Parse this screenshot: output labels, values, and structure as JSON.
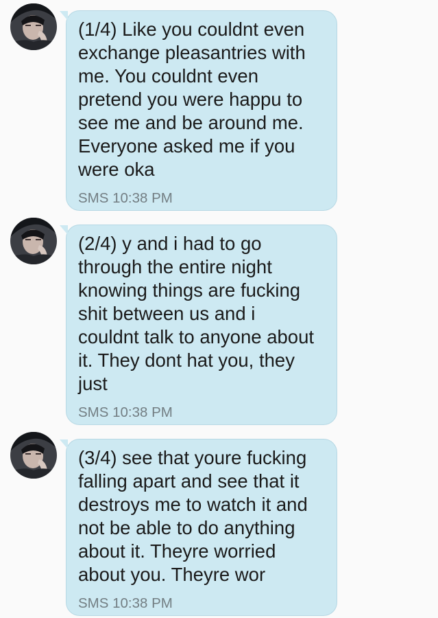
{
  "messages": [
    {
      "text": "(1/4) Like you couldnt even\nexchange pleasantries with\nme. You couldnt even\npretend you were happu to\nsee me and be around me.\nEveryone asked me if you\nwere oka",
      "meta": "SMS 10:38 PM",
      "avatar": "contact-avatar-photo"
    },
    {
      "text": "(2/4) y and i had to go\nthrough the entire night\nknowing things are fucking\nshit between us and i\ncouldnt talk to anyone about\nit. They dont hat you, they\njust",
      "meta": "SMS 10:38 PM",
      "avatar": "contact-avatar-photo"
    },
    {
      "text": "(3/4) see that youre fucking\nfalling apart and see that it\ndestroys me to watch it and\nnot be able to do anything\nabout it. Theyre worried\nabout you. Theyre wor",
      "meta": "SMS 10:38 PM",
      "avatar": "contact-avatar-photo"
    }
  ],
  "colors": {
    "background": "#fafafa",
    "bubble": "#cde9f2",
    "bubble_border": "#b6d8e4",
    "text": "#1a1a1a",
    "meta": "#737e83"
  }
}
